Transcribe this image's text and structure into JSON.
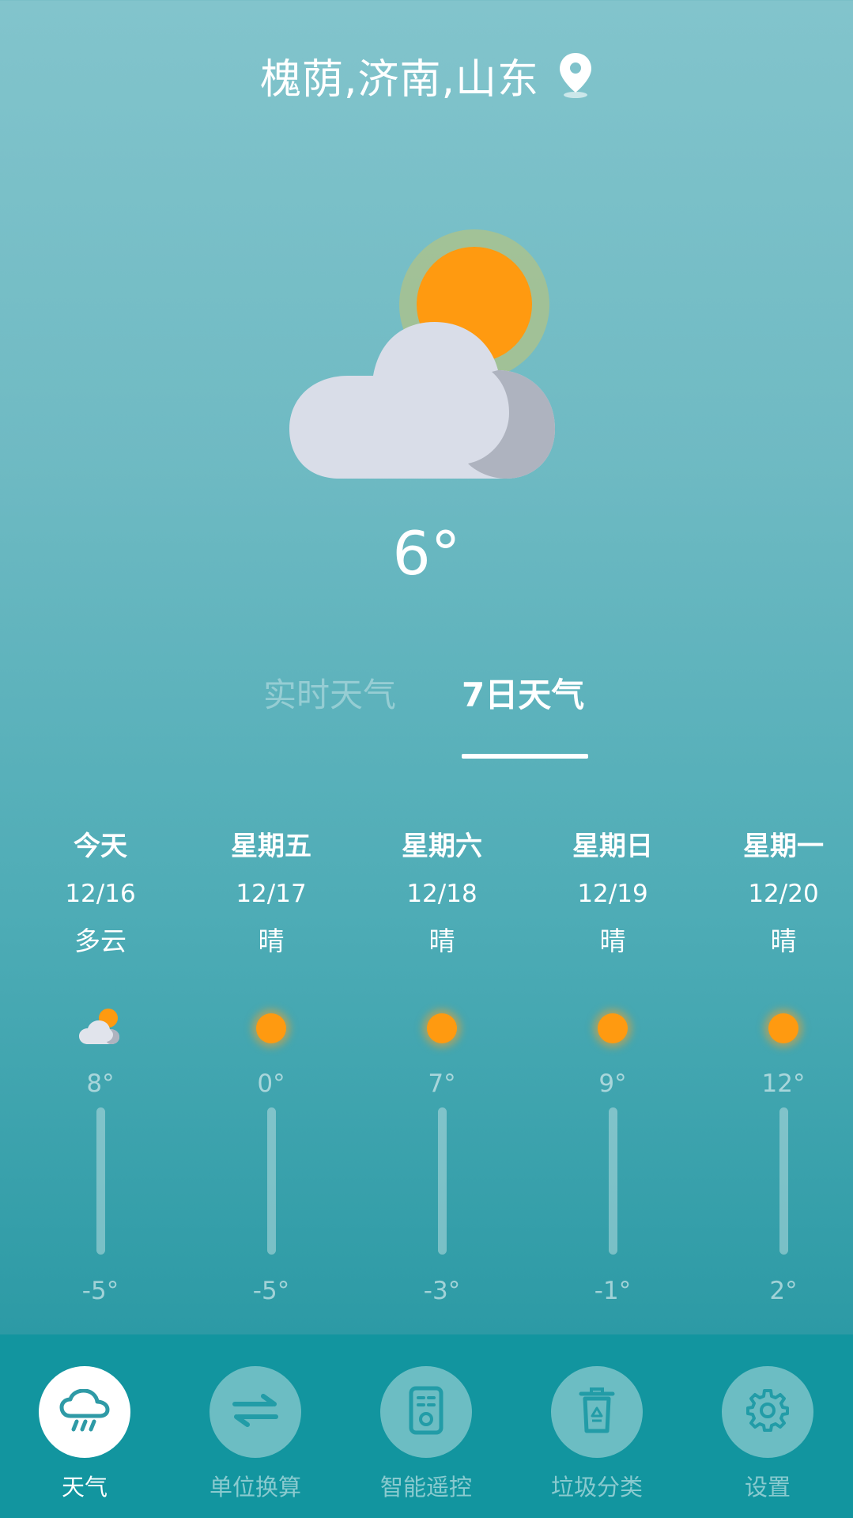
{
  "header": {
    "location": "槐荫,济南,山东",
    "location_icon": "location-pin-icon"
  },
  "current": {
    "temperature": "6°",
    "icon": "partly-cloudy-icon"
  },
  "tabs": [
    {
      "label": "实时天气",
      "active": false
    },
    {
      "label": "7日天气",
      "active": true
    }
  ],
  "forecast": [
    {
      "day": "今天",
      "date": "12/16",
      "condition": "多云",
      "icon": "partly-cloudy-icon",
      "high": "8°",
      "low": "-5°"
    },
    {
      "day": "星期五",
      "date": "12/17",
      "condition": "晴",
      "icon": "sun-icon",
      "high": "0°",
      "low": "-5°"
    },
    {
      "day": "星期六",
      "date": "12/18",
      "condition": "晴",
      "icon": "sun-icon",
      "high": "7°",
      "low": "-3°"
    },
    {
      "day": "星期日",
      "date": "12/19",
      "condition": "晴",
      "icon": "sun-icon",
      "high": "9°",
      "low": "-1°"
    },
    {
      "day": "星期一",
      "date": "12/20",
      "condition": "晴",
      "icon": "sun-icon",
      "high": "12°",
      "low": "2°"
    }
  ],
  "nav": [
    {
      "label": "天气",
      "icon": "cloud-rain-icon",
      "active": true
    },
    {
      "label": "单位换算",
      "icon": "swap-arrows-icon",
      "active": false
    },
    {
      "label": "智能遥控",
      "icon": "remote-control-icon",
      "active": false
    },
    {
      "label": "垃圾分类",
      "icon": "recycle-bin-icon",
      "active": false
    },
    {
      "label": "设置",
      "icon": "gear-icon",
      "active": false
    }
  ],
  "colors": {
    "accent": "#12959f",
    "sun": "#ff9a10",
    "cloud": "#d9dde8",
    "cloud_shadow": "#aeb3bf"
  }
}
